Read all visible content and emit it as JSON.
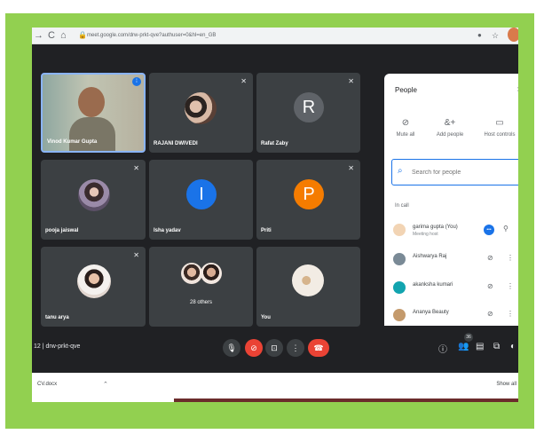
{
  "browser": {
    "back_icon": "arrow-left-icon",
    "forward_icon": "arrow-right-icon",
    "reload_icon": "reload-icon",
    "home_icon": "home-icon",
    "url": "meet.google.com/drw-prkt-qve?authuser=0&hl=en_GB"
  },
  "tiles": [
    {
      "name": "Vinod Kumar Gupta",
      "kind": "video"
    },
    {
      "name": "RAJANI DWIVEDI",
      "kind": "photo"
    },
    {
      "name": "Rafat Zaby",
      "kind": "letter",
      "letter": "R",
      "color": "#5f6368"
    },
    {
      "name": "pooja jaiswal",
      "kind": "photo"
    },
    {
      "name": "Isha yadav",
      "kind": "letter",
      "letter": "I",
      "color": "#1a73e8"
    },
    {
      "name": "Priti",
      "kind": "letter",
      "letter": "P",
      "color": "#f57c00"
    },
    {
      "name": "tanu arya",
      "kind": "photo"
    },
    {
      "name": "28 others",
      "kind": "group"
    },
    {
      "name": "You",
      "kind": "photo"
    }
  ],
  "people_panel": {
    "title": "People",
    "actions": [
      {
        "label": "Mute all",
        "icon": "mic-off-icon"
      },
      {
        "label": "Add people",
        "icon": "add-person-icon"
      },
      {
        "label": "Host controls",
        "icon": "host-controls-icon"
      }
    ],
    "search_placeholder": "Search for people",
    "section_label": "In call",
    "participants": [
      {
        "name": "garima gupta (You)",
        "sub": "Meeting host",
        "color": "#f2d4b4"
      },
      {
        "name": "Aishwarya Raj",
        "sub": "",
        "color": "#7a8a96"
      },
      {
        "name": "akanksha kumari",
        "sub": "",
        "color": "#12a4af"
      },
      {
        "name": "Ananya Beauty",
        "sub": "",
        "color": "#c49a6c"
      }
    ]
  },
  "toolbar": {
    "meeting_code": "12  |  drw-prkt-qve",
    "participant_count": "36"
  },
  "downloads": {
    "file": "CV.docx",
    "show_all": "Show all"
  }
}
